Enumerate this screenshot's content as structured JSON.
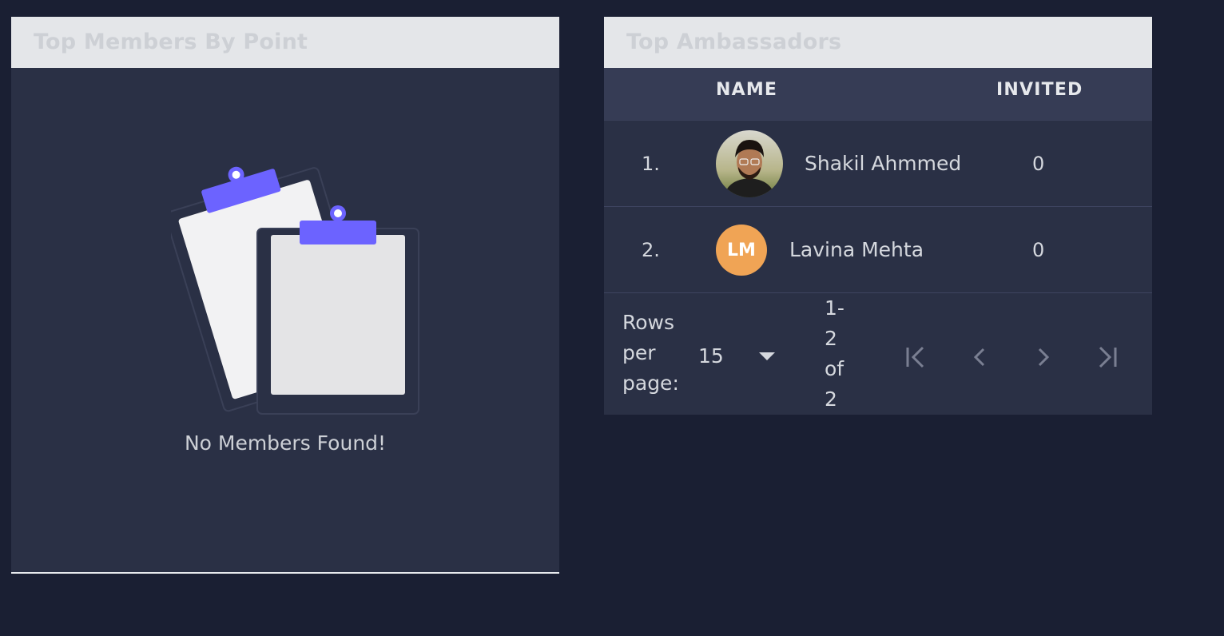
{
  "members_panel": {
    "title": "Top Members By Point",
    "empty_message": "No Members Found!"
  },
  "ambassadors_panel": {
    "title": "Top Ambassadors",
    "columns": [
      "NAME",
      "INVITED"
    ],
    "rows": [
      {
        "rank": "1.",
        "name": "Shakil Ahmmed",
        "invited": "0",
        "avatar": "photo"
      },
      {
        "rank": "2.",
        "name": "Lavina Mehta",
        "invited": "0",
        "avatar_initials": "LM"
      }
    ],
    "pagination": {
      "rows_per_page_label": "Rows per page:",
      "rows_per_page_value": "15",
      "range_text": "1-2 of 2"
    }
  },
  "colors": {
    "background": "#1a1f33",
    "panel": "#2a3045",
    "header": "#e4e6e9",
    "accent": "#6c63ff",
    "initials_avatar": "#f0a455"
  }
}
